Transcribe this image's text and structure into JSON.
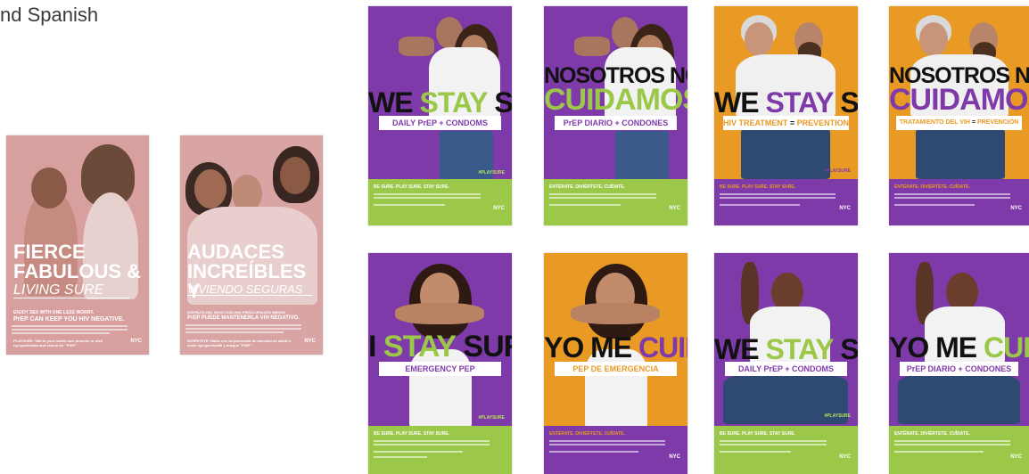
{
  "caption": "nd Spanish",
  "colors": {
    "purple": "#7f3aa9",
    "orange": "#e89a25",
    "green": "#9cc84a",
    "pink": "#d9a3a2",
    "lime": "#b7e35a"
  },
  "posters": [
    {
      "id": "fierce",
      "type": "pink",
      "headline1": "FIERCE",
      "headline2": "FABULOUS &",
      "sub": "LIVING SURE",
      "intro": "ENJOY SEX WITH ONE LESS WORRY.",
      "callout": "PrEP CAN KEEP YOU HIV NEGATIVE.",
      "footer": "PLAYSURE: Talk to your health care provider or visit nyc.gov/health and search for \"PrEP.\"",
      "logo": "NYC"
    },
    {
      "id": "audaces",
      "type": "pink",
      "headline1": "AUDACES",
      "headline2": "INCREÍBLES Y",
      "sub": "VIVIENDO SEGURAS",
      "intro": "DISFRUTA DEL SEXO CON UNA PREOCUPACIÓN MENOS.",
      "callout": "PrEP PUEDE MANTENERLA VIH NEGATIVO.",
      "footer": "DIVIÉRTETE: Hable con su proveedor de atención de salud o visite nyc.gov/health y busque \"PrEP\".",
      "logo": "NYC"
    },
    {
      "id": "we-stay-daily",
      "type": "purple",
      "w1": "WE",
      "w2": "STAY",
      "w3": "SURE",
      "label": "DAILY PrEP + CONDOMS",
      "tag": "#PLAYSURE",
      "btitle": "BE SURE. PLAY SURE. STAY SURE.",
      "logo": "NYC"
    },
    {
      "id": "nosotros-diario",
      "type": "purple",
      "w1": "NOSOTROS NOS",
      "w2": "CUIDAMOS",
      "label": "PrEP DIARIO + CONDONES",
      "btitle": "ENTÉRATE. DIVIÉRTETE. CUÍDATE.",
      "logo": "NYC"
    },
    {
      "id": "we-stay-hiv",
      "type": "orange",
      "w1": "WE",
      "w2": "STAY",
      "w3": "SURE",
      "labelA": "HIV TREATMENT",
      "labelB": "PREVENTION",
      "tag": "#PLAYSURE",
      "btitle": "BE SURE. PLAY SURE. STAY SURE.",
      "logo": "NYC"
    },
    {
      "id": "nosotros-vih",
      "type": "orange",
      "w1": "NOSOTROS NOS",
      "w2": "CUIDAMOS",
      "labelA": "TRATAMIENTO DEL VIH",
      "labelB": "PREVENCIÓN",
      "btitle": "ENTÉRATE. DIVIÉRTETE. CUÍDATE.",
      "logo": "NYC"
    },
    {
      "id": "i-stay",
      "type": "purple",
      "w1": "I",
      "w2": "STAY",
      "w3": "SURE",
      "label": "EMERGENCY PEP",
      "tag": "#PLAYSURE",
      "btitle": "BE SURE. PLAY SURE. STAY SURE.",
      "logo": "NYC"
    },
    {
      "id": "yo-me-cuido-pep",
      "type": "orange",
      "w1": "YO ME",
      "w2": "CUIDO",
      "label": "PEP DE EMERGENCIA",
      "btitle": "ENTÉRATE. DIVIÉRTETE. CUÍDATE.",
      "logo": "NYC"
    },
    {
      "id": "we-stay-man",
      "type": "purple",
      "w1": "WE",
      "w2": "STAY",
      "w3": "SURE",
      "label": "DAILY PrEP + CONDOMS",
      "tag": "#PLAYSURE",
      "btitle": "BE SURE. PLAY SURE. STAY SURE.",
      "logo": "NYC"
    },
    {
      "id": "yo-me-cuido-diario",
      "type": "purple",
      "w1": "YO ME",
      "w2": "CUIDO",
      "label": "PrEP DIARIO + CONDONES",
      "btitle": "ENTÉRATE. DIVIÉRTETE. CUÍDATE.",
      "logo": "NYC"
    }
  ]
}
